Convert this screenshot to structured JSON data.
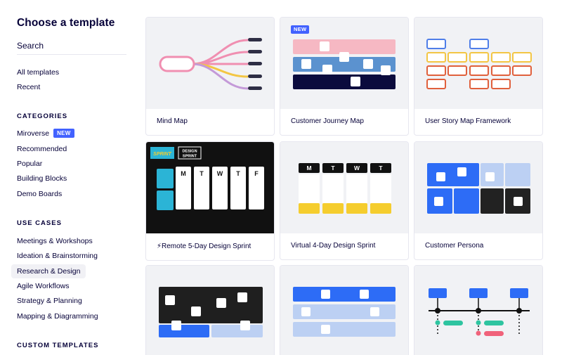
{
  "title": "Choose a template",
  "search": {
    "placeholder": "Search"
  },
  "nav_top": [
    "All templates",
    "Recent"
  ],
  "sections": {
    "categories": "CATEGORIES",
    "use_cases": "USE CASES",
    "custom": "CUSTOM TEMPLATES"
  },
  "categories": [
    {
      "label": "Miroverse",
      "badge": "NEW"
    },
    {
      "label": "Recommended"
    },
    {
      "label": "Popular"
    },
    {
      "label": "Building Blocks"
    },
    {
      "label": "Demo Boards"
    }
  ],
  "use_cases": [
    "Meetings & Workshops",
    "Ideation & Brainstorming",
    "Research & Design",
    "Agile Workflows",
    "Strategy & Planning",
    "Mapping & Diagramming"
  ],
  "active_use_case": "Research & Design",
  "templates": [
    {
      "name": "Mind Map"
    },
    {
      "name": "Customer Journey Map",
      "badge": "NEW"
    },
    {
      "name": "User Story Map Framework"
    },
    {
      "name": "⚡Remote 5-Day Design Sprint",
      "thumb_text": {
        "sprint": "SPRINT",
        "design_sprint_1": "DESIGN",
        "design_sprint_2": "SPRINT",
        "days": [
          "M",
          "T",
          "W",
          "T",
          "F"
        ]
      }
    },
    {
      "name": "Virtual 4-Day Design Sprint",
      "thumb_text": {
        "days": [
          "M",
          "T",
          "W",
          "T"
        ]
      }
    },
    {
      "name": "Customer Persona"
    },
    {
      "name": ""
    },
    {
      "name": ""
    },
    {
      "name": ""
    }
  ],
  "colors": {
    "accent": "#4262ff",
    "text": "#050038",
    "thumb_bg": "#f1f2f5",
    "sprint_dark": "#111111",
    "sprint_cyan": "#2bb4d6",
    "yellow": "#f5cd2e",
    "blue": "#2d6cf6",
    "light_blue": "#bcd0f3",
    "pink": "#f6b8c3",
    "steel_blue": "#5b92cf",
    "navy": "#0b0b3d",
    "orange": "#e0603c",
    "user_story_yellow": "#f3c644",
    "user_story_blue": "#4f7ee8"
  }
}
